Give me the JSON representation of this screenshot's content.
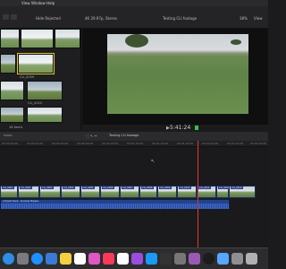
{
  "menubar": {
    "items": [
      "View",
      "Window",
      "Help"
    ]
  },
  "toolbar": {
    "filter": "Hide Rejected",
    "format": "4K 29.97p, Stereo",
    "project": "Testing CLI footage",
    "zoom": "38%",
    "view": "View"
  },
  "browser": {
    "clips": [
      "CLI_0009",
      "CLI_0022",
      "CLI_0026"
    ],
    "footer": "16 items"
  },
  "viewer": {
    "timecode": "5:41:24"
  },
  "timeline": {
    "index": "Index",
    "project": "Testing CLI footage",
    "ruler": [
      "00:00:00:00",
      "00:00:15:00",
      "00:00:30:00",
      "00:00:45:00",
      "00:01:00:00",
      "00:01:15:00",
      "00:01:30:00",
      "00:01:45:00",
      "00:02:00:00",
      "00:02:15:00",
      "00:02:30:00"
    ],
    "clips": [
      "CLI_0001",
      "CLI_0002",
      "CLI_0003",
      "CLI_0004",
      "CLI_0005",
      "CLI_0006",
      "CLI_0007",
      "CLI_0008",
      "CLI_0009",
      "CLI_0010",
      "CLI_0011",
      "CLI_0012",
      "CLI_0013"
    ],
    "audio_label": "Lofi Jazz Track - Summer Breeze"
  },
  "dock": {
    "icons": [
      "finder-icon",
      "launchpad-icon",
      "safari-icon",
      "mail-icon",
      "notes-icon",
      "reminders-icon",
      "photos-icon",
      "music-icon",
      "calendar-icon",
      "podcasts-icon",
      "appstore-icon",
      "fcp-icon",
      "compressor-icon",
      "motion-icon",
      "monitor-icon",
      "preview-icon",
      "settings-icon",
      "trash-icon"
    ],
    "colors": [
      "#2f8de4",
      "#7a7a80",
      "#1e90ff",
      "#3a7bd5",
      "#f4d03f",
      "#ffffff",
      "#e056c5",
      "#fa3a5a",
      "#ffffff",
      "#9b4de0",
      "#1a9af7",
      "#333333",
      "#777777",
      "#9b59b6",
      "#1c1c1c",
      "#58a6ff",
      "#8e8e93",
      "#b0b0b0"
    ]
  }
}
